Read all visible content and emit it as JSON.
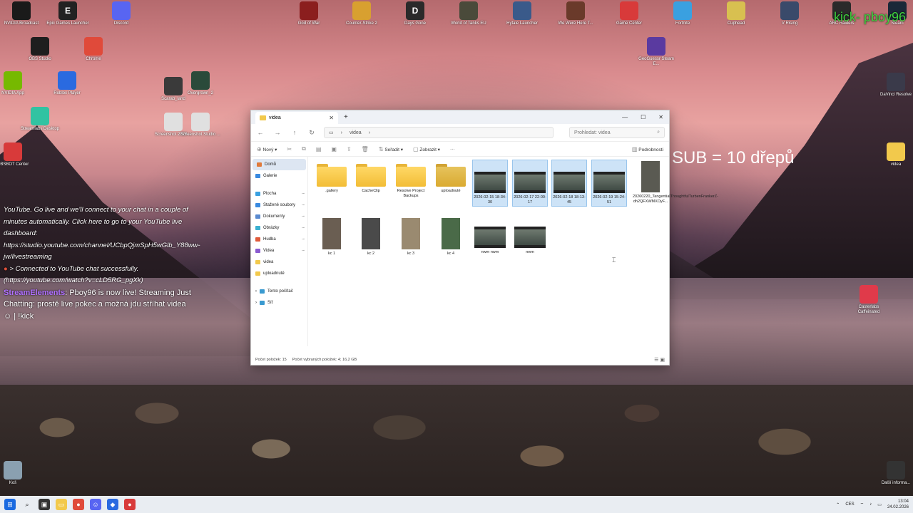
{
  "overlay": {
    "kick": "kick- pboy96",
    "sub": "SUB = 10 dřepů"
  },
  "desktop_icons": [
    {
      "label": "NVIDIA Broadcast",
      "color": "#1a1a1a"
    },
    {
      "label": "Epic Games Launcher",
      "color": "#222222",
      "glyph": "EPIC"
    },
    {
      "label": "Discord",
      "color": "#5865f2"
    },
    {
      "label": "God of War",
      "color": "#8b1e1e"
    },
    {
      "label": "Counter-Strike 2",
      "color": "#d8a030"
    },
    {
      "label": "Days Gone",
      "color": "#2a2a2a",
      "glyph": "DG"
    },
    {
      "label": "World of Tanks EU",
      "color": "#4a4a3a"
    },
    {
      "label": "Hytale Launcher",
      "color": "#3a5a8a"
    },
    {
      "label": "We Were Here T...",
      "color": "#6a3a2a"
    },
    {
      "label": "Game Center",
      "color": "#d83a3a"
    },
    {
      "label": "Fortnite",
      "color": "#3aa0e0"
    },
    {
      "label": "Cuphead",
      "color": "#d8c050"
    },
    {
      "label": "V Rising",
      "color": "#3a4a6a"
    },
    {
      "label": "ARC Raiders",
      "color": "#2a2a2a"
    },
    {
      "label": "Steam",
      "color": "#1b2838"
    },
    {
      "label": "OBS Studio",
      "color": "#1e1e1e"
    },
    {
      "label": "Chrome",
      "color": "#e04a3a"
    },
    {
      "label": "GeoGuessr Steam E...",
      "color": "#5a3aa0"
    },
    {
      "label": "NVIDIA App",
      "color": "#76b900"
    },
    {
      "label": "Roblox Player",
      "color": "#2a6ae0"
    },
    {
      "label": "Scarab_land",
      "color": "#3a3a3a"
    },
    {
      "label": "Overgrown_2",
      "color": "#2a4a3a"
    },
    {
      "label": "DaVinci Resolve",
      "color": "#3a3a4a"
    },
    {
      "label": "Streamlabs Desktop",
      "color": "#31c3a2"
    },
    {
      "label": "Screenshot 2026 ...",
      "color": "#e0e0e0"
    },
    {
      "label": "Screenshot Studio ...",
      "color": "#e0e0e0"
    },
    {
      "label": "videa",
      "color": "#f2c94c"
    },
    {
      "label": "OBSBOT Center",
      "color": "#d83a3a"
    },
    {
      "label": "Casterlabs Caffeinated",
      "color": "#e03a4a"
    },
    {
      "label": "Koš",
      "color": "#8aa0b0"
    },
    {
      "label": "Další informa...",
      "color": "#333333"
    }
  ],
  "chat": {
    "line1": "YouTube. Go live and we'll connect to your chat in a couple of minutes automatically. Click here to go to your YouTube live dashboard: https://studio.youtube.com/channel/UCbpQjmSpH5wGlb_Y88ww-jw/livestreaming",
    "line2": "> Connected to YouTube chat successfully. (https://youtube.com/watch?v=cLD5RG_pgXk)",
    "se_name": "StreamElements",
    "line3": ": Pboy96 is now live! Streaming Just Chatting: prostě live pokec a možná jdu stříhat videa",
    "line4": "| !kick"
  },
  "explorer": {
    "tab_title": "videa",
    "tab_new": "+",
    "address": "videa",
    "search_placeholder": "Prohledat: videa",
    "toolbar": {
      "new": "Nový",
      "sort": "Seřadit",
      "view": "Zobrazit",
      "more": "···",
      "details": "Podrobnosti"
    },
    "sidebar": [
      {
        "label": "Domů",
        "color": "#e07a3a",
        "pin": false
      },
      {
        "label": "Galerie",
        "color": "#3a8ae0",
        "pin": false
      },
      {
        "label": "Plocha",
        "color": "#3aa0e0",
        "pin": true
      },
      {
        "label": "Stažené soubory",
        "color": "#3a8ae0",
        "pin": true
      },
      {
        "label": "Dokumenty",
        "color": "#5a8ad0",
        "pin": true
      },
      {
        "label": "Obrázky",
        "color": "#3ab0d0",
        "pin": true
      },
      {
        "label": "Hudba",
        "color": "#e05a3a",
        "pin": true
      },
      {
        "label": "Videa",
        "color": "#8a5ad0",
        "pin": true
      },
      {
        "label": "videa",
        "color": "#f2c94c",
        "pin": false
      },
      {
        "label": "uploadnuté",
        "color": "#f2c94c",
        "pin": false
      },
      {
        "label": "Tento počítač",
        "color": "#3a9ad0",
        "pin": false
      },
      {
        "label": "Síť",
        "color": "#3a9ad0",
        "pin": false
      }
    ],
    "files": [
      {
        "name": ".gallery",
        "kind": "folder",
        "selected": false
      },
      {
        "name": "CacheClip",
        "kind": "folder",
        "selected": false
      },
      {
        "name": "Resolve Project Backups",
        "kind": "folder",
        "selected": false
      },
      {
        "name": "uploadnuté",
        "kind": "folder-dark",
        "selected": false
      },
      {
        "name": "2026-02-15 18-34-30",
        "kind": "video",
        "selected": true
      },
      {
        "name": "2026-02-17 22-00-17",
        "kind": "video",
        "selected": true
      },
      {
        "name": "2026-02-18 18-13-45",
        "kind": "video",
        "selected": true
      },
      {
        "name": "2026-02-19 15-24-51",
        "kind": "video",
        "selected": true
      },
      {
        "name": "20260220_TangentialThoughtfulTurbenFrankerZ-dh2QFXWMXOyF...",
        "kind": "image",
        "selected": false
      },
      {
        "name": "kc 1",
        "kind": "image",
        "selected": false
      },
      {
        "name": "kc 2",
        "kind": "image",
        "selected": false
      },
      {
        "name": "kc 3",
        "kind": "image",
        "selected": false
      },
      {
        "name": "kc 4",
        "kind": "image",
        "selected": false
      },
      {
        "name": "nwm nwm",
        "kind": "video",
        "selected": false
      },
      {
        "name": "nwm",
        "kind": "video",
        "selected": false
      }
    ],
    "status_count": "Počet položek: 15",
    "status_selected": "Počet vybraných položek: 4; 16,2 GB"
  },
  "taskbar": {
    "lang": "CES",
    "time": "13:04",
    "date": "24.02.2026"
  }
}
